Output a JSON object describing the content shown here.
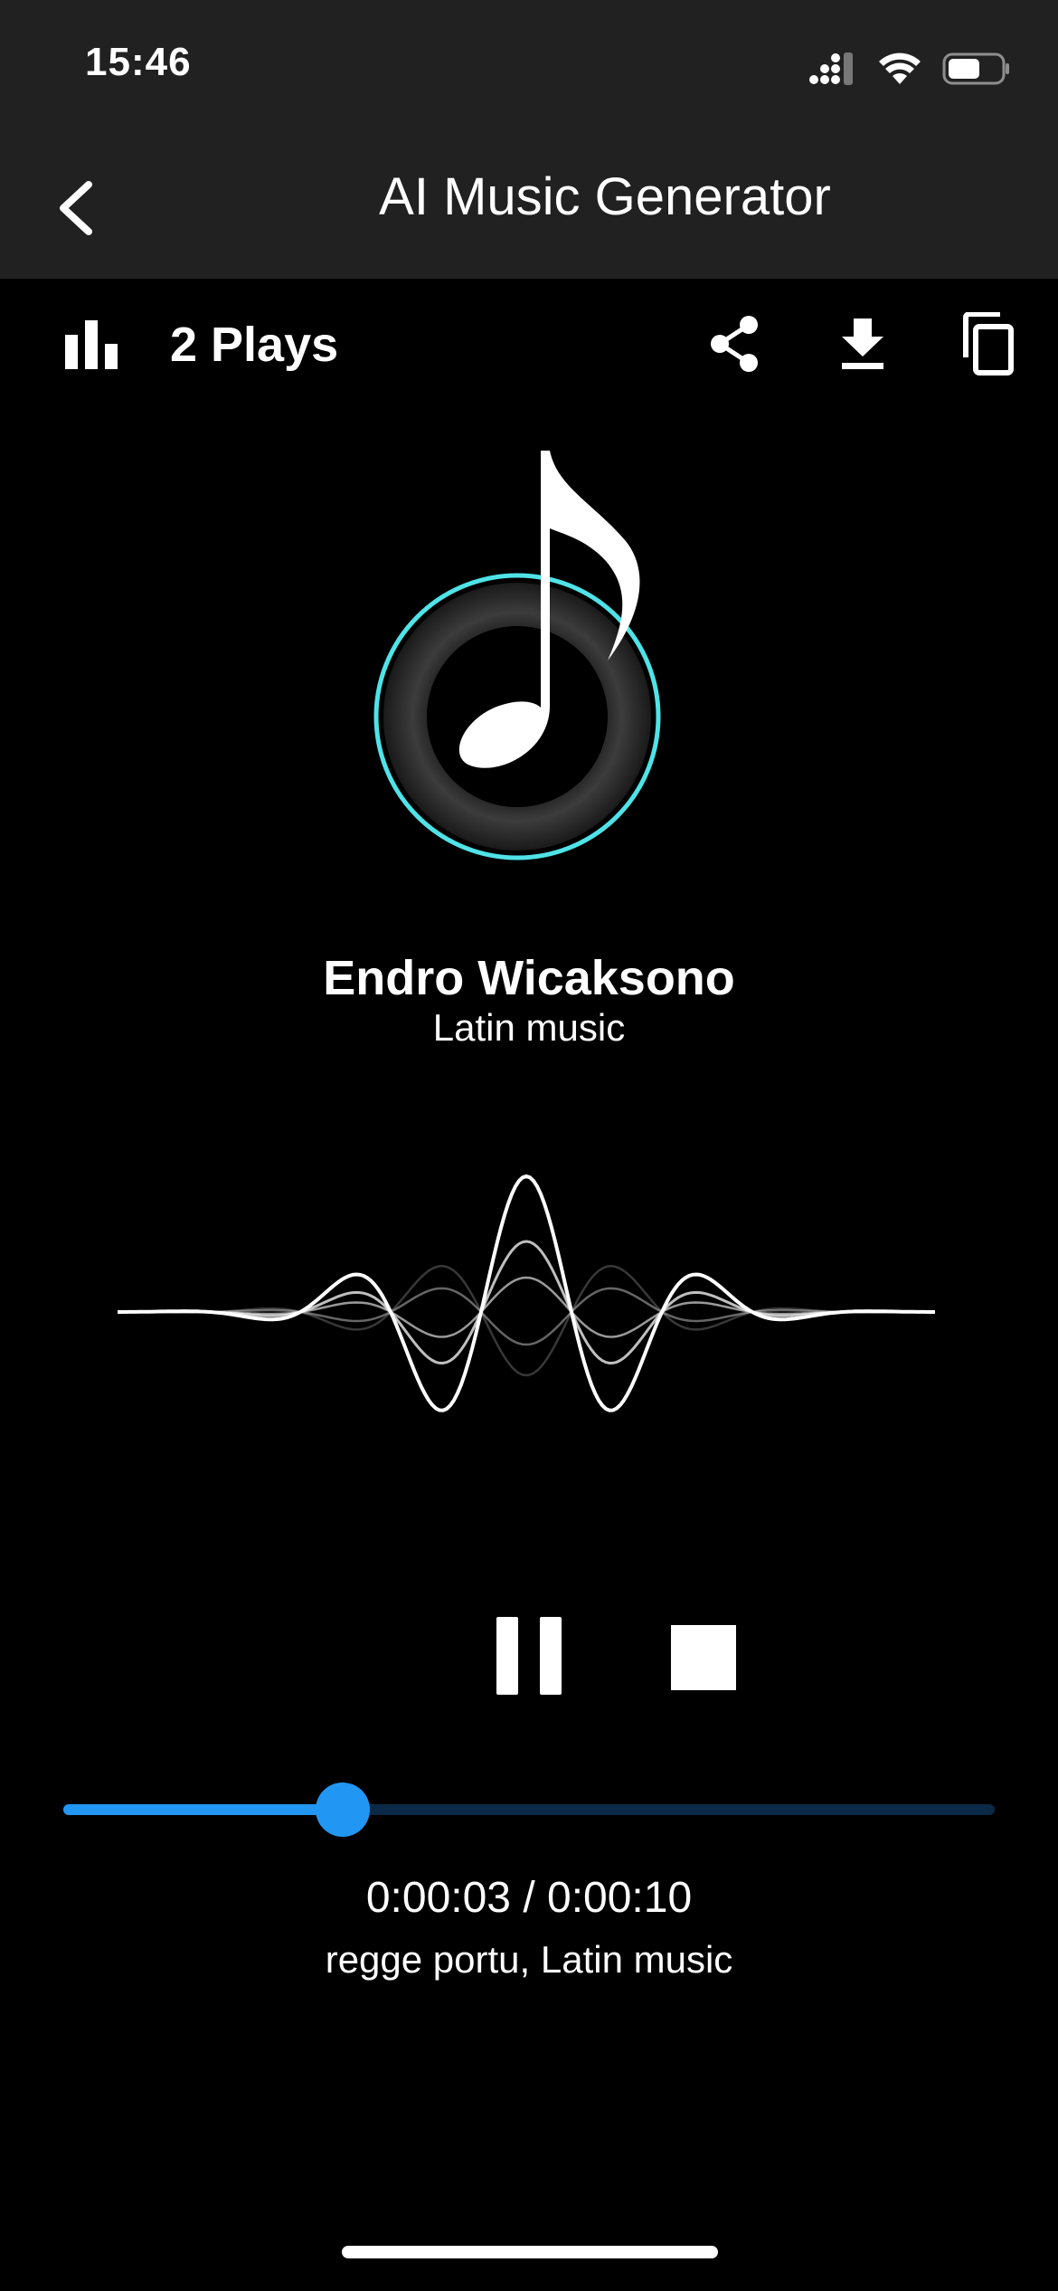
{
  "status_bar": {
    "time": "15:46",
    "battery_level": 0.6
  },
  "header": {
    "title": "AI Music Generator",
    "back_icon": "chevron-left-icon"
  },
  "actions": {
    "plays_label": "2 Plays",
    "plays_icon": "bar-chart-icon",
    "share_icon": "share-icon",
    "download_icon": "download-icon",
    "copy_icon": "copy-icon"
  },
  "track": {
    "artist": "Endro Wicaksono",
    "genre": "Latin music",
    "time": "0:00:03 / 0:00:10",
    "tags": "regge portu, Latin music",
    "progress": 0.3
  },
  "controls": {
    "pause_icon": "pause-icon",
    "stop_icon": "stop-icon"
  },
  "colors": {
    "accent": "#2196F3",
    "accent_track": "#0B2A47",
    "logo_ring": "#4FE3E8",
    "header_bg": "#212121",
    "background": "#000000"
  }
}
